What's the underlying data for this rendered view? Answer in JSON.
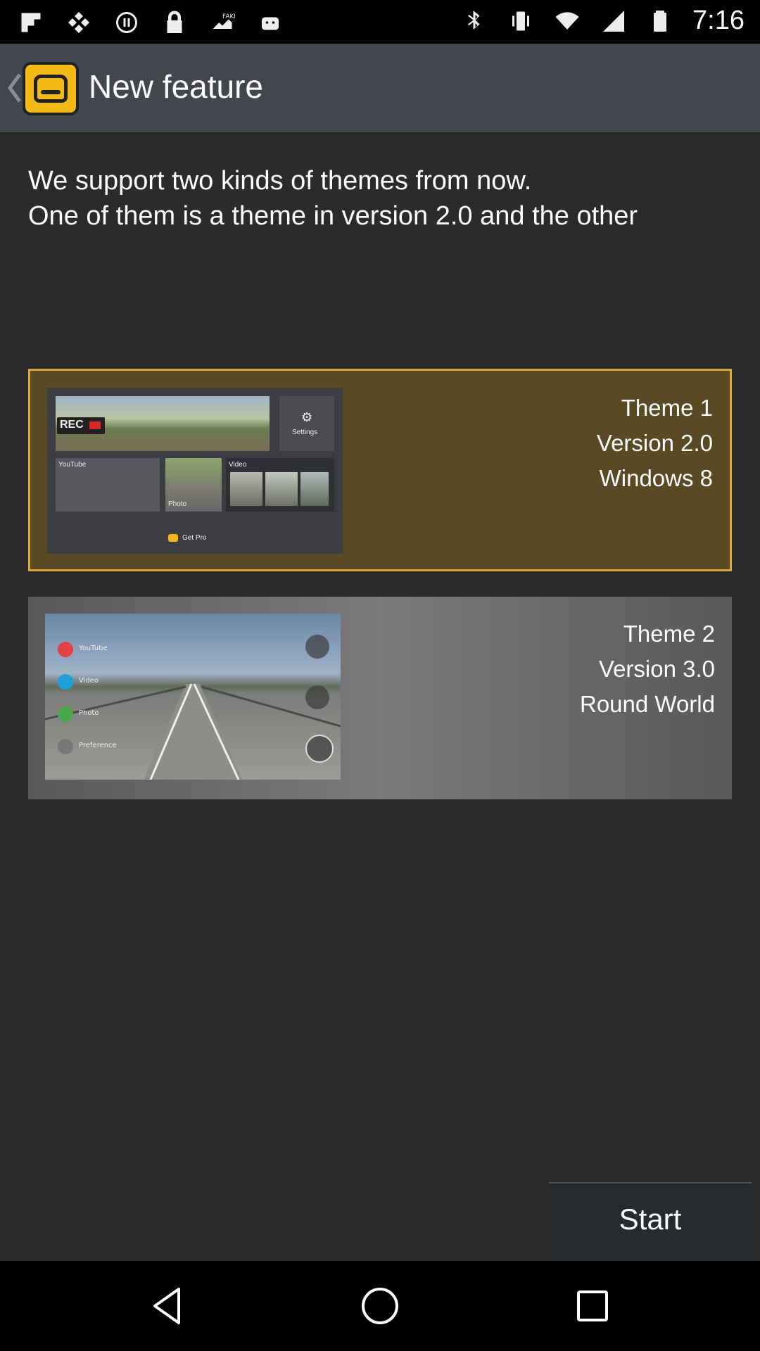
{
  "status_bar": {
    "left_icons": [
      "flipboard-icon",
      "photo-icon",
      "media-icon",
      "lock-icon",
      "fake-gps-icon",
      "android-icon"
    ],
    "right_icons": [
      "bluetooth-icon",
      "vibrate-icon",
      "wifi-icon",
      "signal-icon",
      "battery-icon"
    ],
    "time": "7:16"
  },
  "app_bar": {
    "title": "New feature",
    "back_icon": "chevron-left-icon",
    "logo_icon": "app-logo-icon"
  },
  "description": {
    "line1": "We support two kinds of themes from now.",
    "line2": "One of them is a theme in version 2.0 and the other"
  },
  "themes": [
    {
      "line1": "Theme 1",
      "line2": "Version 2.0",
      "line3": "Windows 8",
      "thumbnail": {
        "rec_label": "REC",
        "settings_label": "Settings",
        "youtube_label": "YouTube",
        "photo_label": "Photo",
        "video_label": "Video",
        "pro_label": "Get Pro"
      }
    },
    {
      "line1": "Theme 2",
      "line2": "Version 3.0",
      "line3": "Round World",
      "thumbnail": {
        "youtube_label": "YouTube",
        "video_label": "Video",
        "photo_label": "Photo",
        "preference_label": "Preference"
      }
    }
  ],
  "start_button": {
    "label": "Start"
  },
  "nav_bar": {
    "back_icon": "back-triangle-icon",
    "home_icon": "home-circle-icon",
    "recents_icon": "recents-square-icon"
  },
  "colors": {
    "app_bar": "#43464d",
    "content_bg": "#2b2b2b",
    "theme1_bg": "#5a4a24",
    "theme1_border": "#d4a83a",
    "theme2_bg": "#6e6e6e",
    "logo": "#f5b916"
  }
}
